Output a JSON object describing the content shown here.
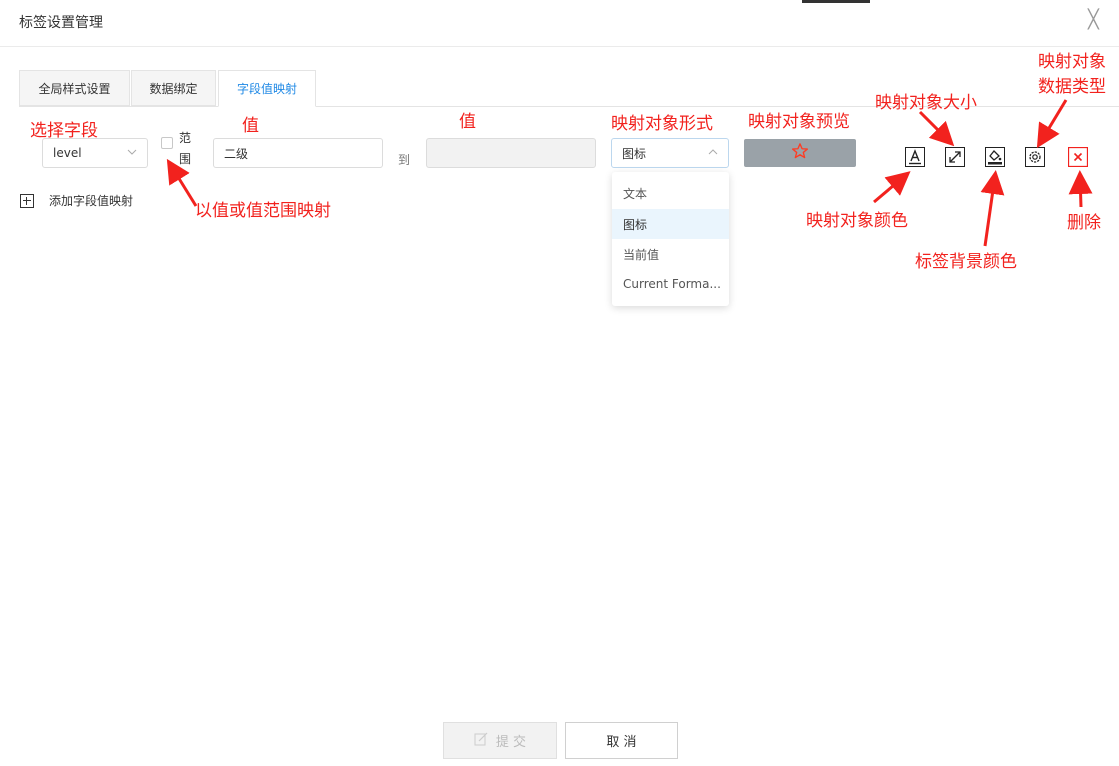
{
  "dialog": {
    "title": "标签设置管理",
    "close_glyph": "╳"
  },
  "tabs": [
    {
      "label": "全局样式设置"
    },
    {
      "label": "数据绑定"
    },
    {
      "label": "字段值映射"
    }
  ],
  "mapping_row": {
    "field_select_value": "level",
    "range_label_1": "范",
    "range_label_2": "围",
    "value_input": "二级",
    "to_label": "到",
    "to_input_value": "",
    "form_select_value": "图标",
    "preview_icon": "star-outline-icon",
    "tools": [
      "font-color-icon",
      "resize-icon",
      "fill-color-icon",
      "settings-gear-icon",
      "delete-x-icon"
    ]
  },
  "dropdown": {
    "options": [
      "文本",
      "图标",
      "当前值",
      "Current Forma..."
    ],
    "selected": "图标"
  },
  "add_mapping_label": "添加字段值映射",
  "annotations": {
    "select_field": "选择字段",
    "value_1": "值",
    "value_2": "值",
    "map_form": "映射对象形式",
    "map_preview": "映射对象预览",
    "map_size": "映射对象大小",
    "map_type_line1": "映射对象",
    "map_type_line2": "数据类型",
    "range_map": "以值或值范围映射",
    "map_color": "映射对象颜色",
    "label_bg_color": "标签背景颜色",
    "delete": "删除"
  },
  "footer": {
    "submit_label": "提 交",
    "cancel_label": "取 消"
  },
  "colors": {
    "accent": "#1e88e5",
    "annotation": "#f2221e",
    "preview_bg": "#9aa2a8",
    "dropdown_selected_bg": "#eaf5fd"
  }
}
